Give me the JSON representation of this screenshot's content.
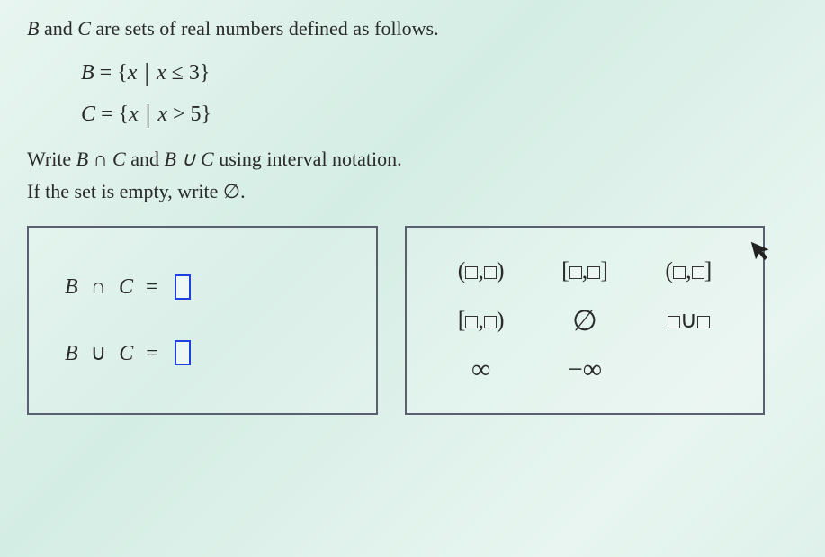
{
  "problem": {
    "intro": " and ",
    "intro_end": " are sets of real numbers defined as follows.",
    "var_b": "B",
    "var_c": "C",
    "set_b": "B = {x | x ≤ 3}",
    "set_c": "C = {x | x > 5}",
    "write_line_1a": "Write ",
    "write_line_1b": " and ",
    "write_line_1c": " using interval notation.",
    "intersection_expr": "B ∩ C",
    "union_expr": "B ∪ C",
    "if_empty": "If the set is empty, write ",
    "empty_symbol": "∅",
    "period": "."
  },
  "answers": {
    "intersection_label": "B ∩ C =",
    "union_label": "B ∪ C ="
  },
  "palette": {
    "open_open": "(▢,▢)",
    "closed_closed": "[▢,▢]",
    "open_closed": "(▢,▢]",
    "closed_open": "[▢,▢)",
    "empty_set": "∅",
    "union_template": "▢∪▢",
    "infinity": "∞",
    "neg_infinity": "−∞"
  }
}
